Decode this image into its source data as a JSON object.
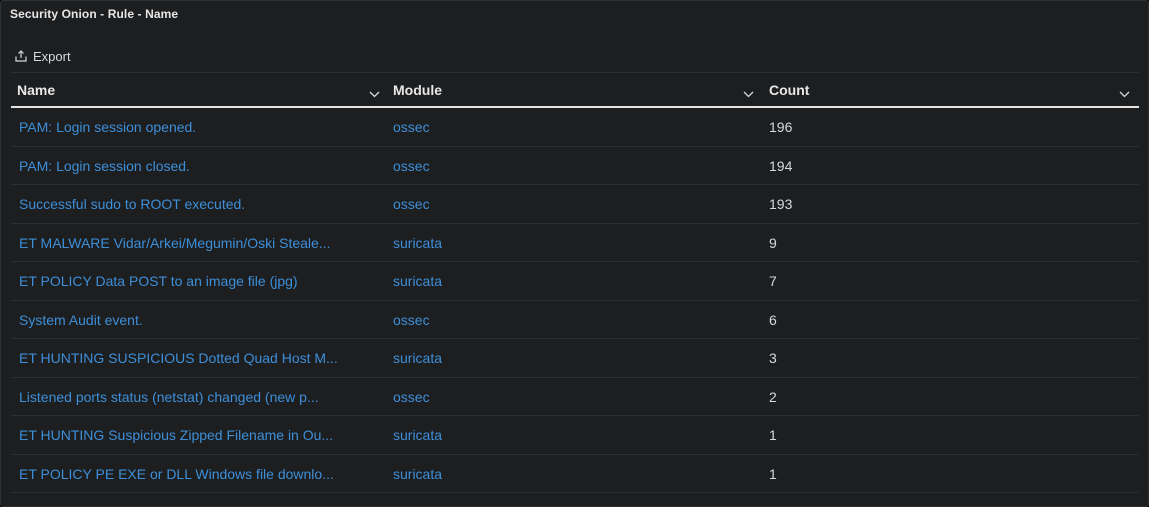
{
  "panel": {
    "title": "Security Onion - Rule - Name",
    "export_label": "Export"
  },
  "table": {
    "columns": [
      {
        "label": "Name"
      },
      {
        "label": "Module"
      },
      {
        "label": "Count"
      }
    ],
    "rows": [
      {
        "name": "PAM: Login session opened.",
        "module": "ossec",
        "count": "196"
      },
      {
        "name": "PAM: Login session closed.",
        "module": "ossec",
        "count": "194"
      },
      {
        "name": "Successful sudo to ROOT executed.",
        "module": "ossec",
        "count": "193"
      },
      {
        "name": "ET MALWARE Vidar/Arkei/Megumin/Oski Steale...",
        "module": "suricata",
        "count": "9"
      },
      {
        "name": "ET POLICY Data POST to an image file (jpg)",
        "module": "suricata",
        "count": "7"
      },
      {
        "name": "System Audit event.",
        "module": "ossec",
        "count": "6"
      },
      {
        "name": "ET HUNTING SUSPICIOUS Dotted Quad Host M...",
        "module": "suricata",
        "count": "3"
      },
      {
        "name": "Listened ports status (netstat) changed (new p...",
        "module": "ossec",
        "count": "2"
      },
      {
        "name": "ET HUNTING Suspicious Zipped Filename in Ou...",
        "module": "suricata",
        "count": "1"
      },
      {
        "name": "ET POLICY PE EXE or DLL Windows file downlo...",
        "module": "suricata",
        "count": "1"
      }
    ]
  },
  "icons": {
    "export": "share-icon",
    "sort": "chevron-down-icon"
  },
  "colors": {
    "background": "#1d1e20",
    "link": "#3d8fd9",
    "text": "#d8d9da"
  }
}
